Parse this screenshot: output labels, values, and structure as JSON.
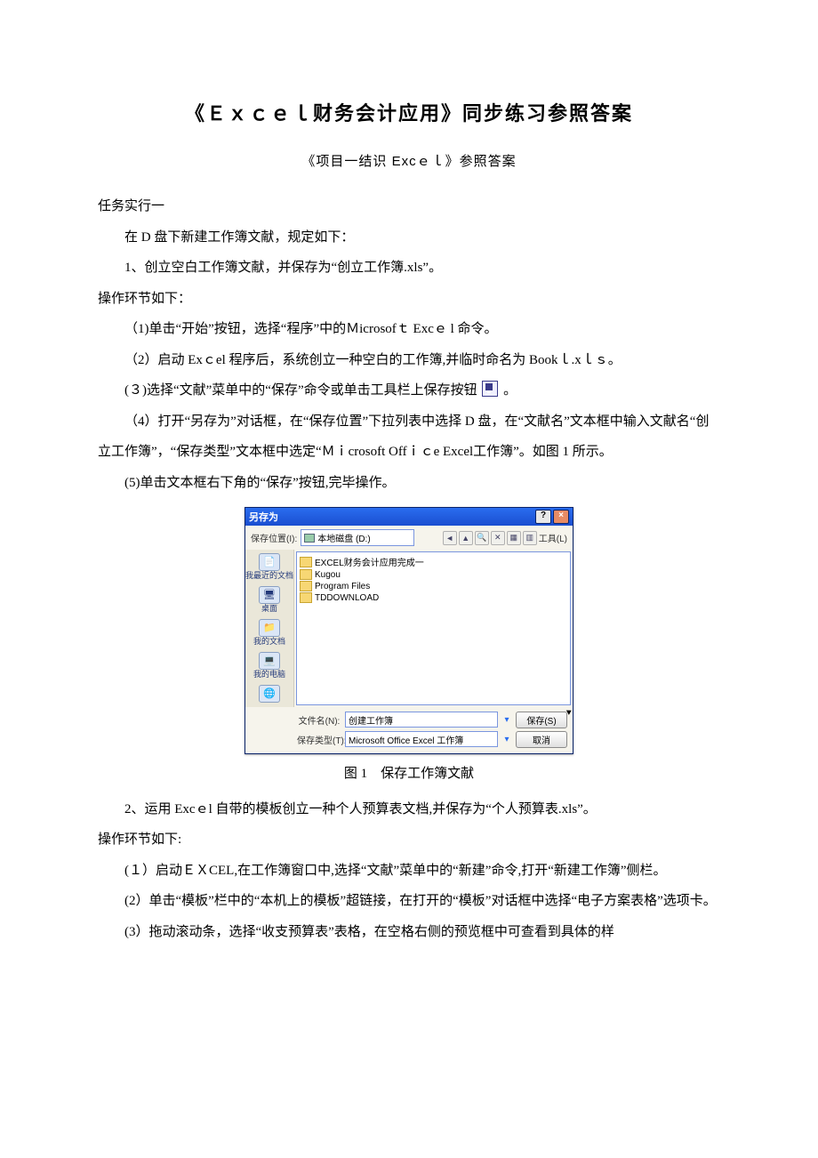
{
  "title": "《Ｅｘｃｅｌ财务会计应用》同步练习参照答案",
  "subtitle": "《项目一结识 Excｅｌ》参照答案",
  "task1_heading": "任务实行一",
  "task1_intro": "在 D 盘下新建工作簿文献，规定如下：",
  "task1_req1": "1、创立空白工作簿文献，并保存为“创立工作簿.xls”。",
  "ops_heading": "操作环节如下：",
  "step1": "（1)单击“开始”按钮，选择“程序”中的Ｍicrosofｔ  Excｅ l 命令。",
  "step2": "（2）启动 Exｃel 程序后，系统创立一种空白的工作簿,并临时命名为 Bookｌ.xｌｓ。",
  "step3_pre": "(３)选择“文献”菜单中的“保存”命令或单击工具栏上保存按钮",
  "step3_post": "。",
  "step4": "（4）打开“另存为”对话框，在“保存位置”下拉列表中选择 D 盘，在“文献名”文本框中输入文献名“创立工作簿”，“保存类型”文本框中选定“Ｍｉcrosoft Offｉｃe Excel工作簿”。如图 1 所示。",
  "step5": "(5)单击文本框右下角的“保存”按钮,完毕操作。",
  "figure1_caption": "图 1　保存工作簿文献",
  "dialog": {
    "title": "另存为",
    "save_loc_label": "保存位置(I):",
    "save_loc_value": "本地磁盘 (D:)",
    "tool_label": "工具(L)",
    "places": [
      {
        "icon": "📄",
        "label": "我最近的文档"
      },
      {
        "icon": "🖥",
        "label": "桌面"
      },
      {
        "icon": "📁",
        "label": "我的文档"
      },
      {
        "icon": "💻",
        "label": "我的电脑"
      },
      {
        "icon": "🌐",
        "label": ""
      }
    ],
    "folders": [
      "EXCEL财务会计应用完成一",
      "Kugou",
      "Program Files",
      "TDDOWNLOAD"
    ],
    "filename_label": "文件名(N):",
    "filename_value": "创建工作簿",
    "filetype_label": "保存类型(T):",
    "filetype_value": "Microsoft Office Excel 工作簿",
    "save_btn": "保存(S)",
    "cancel_btn": "取消"
  },
  "task1_req2": "2、运用 Excｅl 自带的模板创立一种个人预算表文档,并保存为“个人预算表.xls”。",
  "ops2_heading": "操作环节如下:",
  "b_step1": "(１）启动ＥＸCEL,在工作簿窗口中,选择“文献”菜单中的“新建”命令,打开“新建工作簿”侧栏。",
  "b_step2": "(2）单击“模板”栏中的“本机上的模板”超链接，在打开的“模板”对话框中选择“电子方案表格”选项卡。",
  "b_step3": "(3）拖动滚动条，选择“收支预算表”表格，在空格右侧的预览框中可查看到具体的样"
}
